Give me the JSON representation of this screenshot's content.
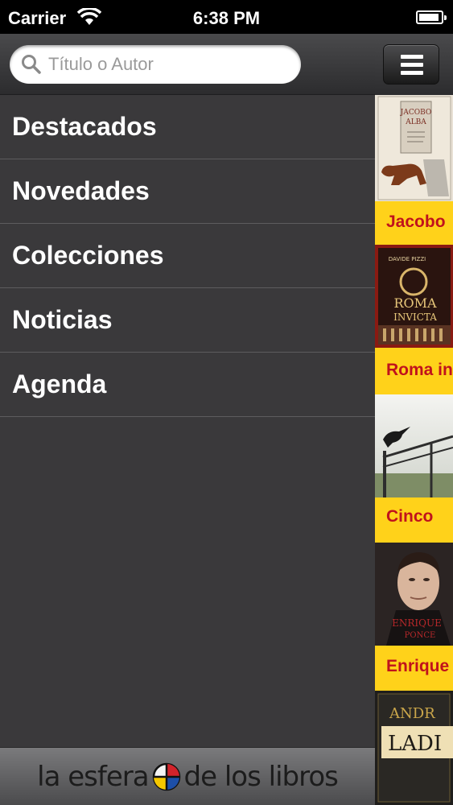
{
  "status_bar": {
    "carrier": "Carrier",
    "time": "6:38 PM"
  },
  "search": {
    "placeholder": "Título o Autor"
  },
  "menu": {
    "items": [
      {
        "label": "Destacados"
      },
      {
        "label": "Novedades"
      },
      {
        "label": "Colecciones"
      },
      {
        "label": "Noticias"
      },
      {
        "label": "Agenda"
      }
    ]
  },
  "footer": {
    "logo_left": "la esfera",
    "logo_right": "de los libros"
  },
  "books": [
    {
      "title": "Jacobo"
    },
    {
      "title": "Roma in"
    },
    {
      "title": "Cinco"
    },
    {
      "title": "Enrique"
    },
    {
      "title": ""
    }
  ],
  "colors": {
    "menu_bg": "#3a393b",
    "accent_yellow": "#ffd21a",
    "title_red": "#c0121c"
  }
}
